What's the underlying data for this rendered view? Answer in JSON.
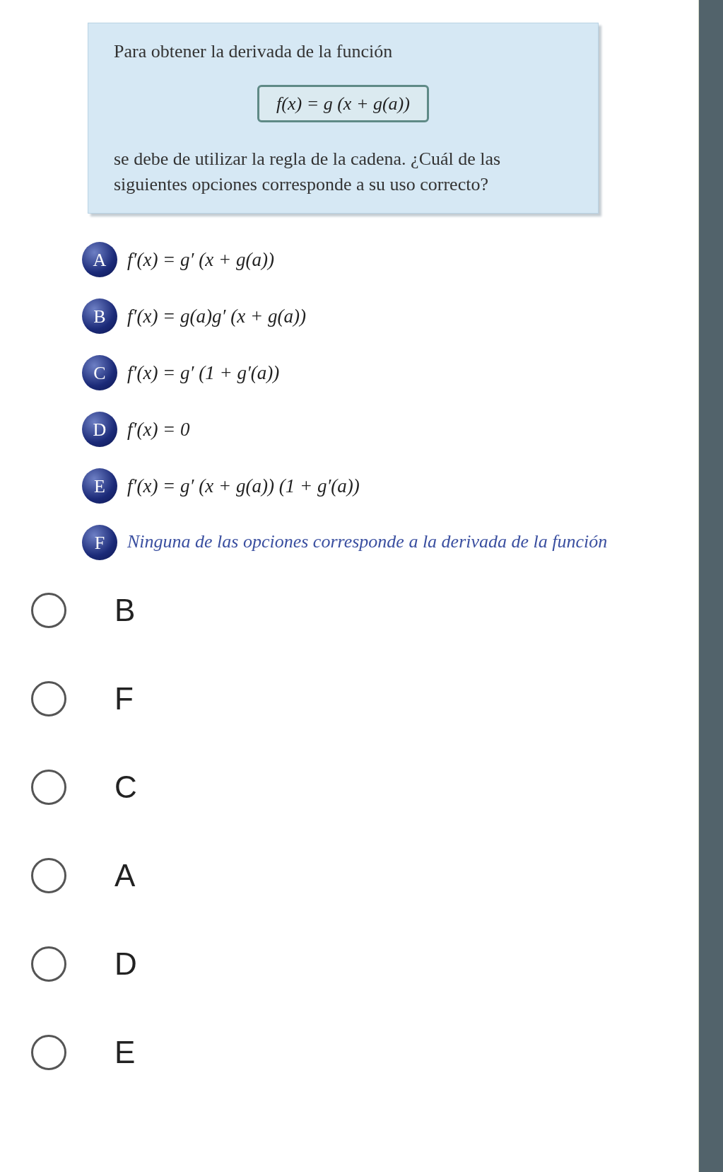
{
  "question": {
    "intro": "Para obtener la derivada de la función",
    "formula": "f(x) = g (x + g(a))",
    "text": "se debe de utilizar la regla de la cadena. ¿Cuál de las siguientes opciones corresponde a su uso correcto?"
  },
  "options": [
    {
      "letter": "A",
      "kind": "formula",
      "text": "f′(x) = g′ (x + g(a))"
    },
    {
      "letter": "B",
      "kind": "formula",
      "text": "f′(x) = g(a)g′ (x + g(a))"
    },
    {
      "letter": "C",
      "kind": "formula",
      "text": "f′(x) = g′ (1 + g′(a))"
    },
    {
      "letter": "D",
      "kind": "formula",
      "text": "f′(x) = 0"
    },
    {
      "letter": "E",
      "kind": "formula",
      "text": "f′(x) = g′ (x + g(a)) (1 + g′(a))"
    },
    {
      "letter": "F",
      "kind": "sentence",
      "text": "Ninguna de las opciones corresponde a la derivada de la función"
    }
  ],
  "answers": [
    {
      "label": "B",
      "selected": false
    },
    {
      "label": "F",
      "selected": false
    },
    {
      "label": "C",
      "selected": false
    },
    {
      "label": "A",
      "selected": false
    },
    {
      "label": "D",
      "selected": false
    },
    {
      "label": "E",
      "selected": false
    }
  ]
}
